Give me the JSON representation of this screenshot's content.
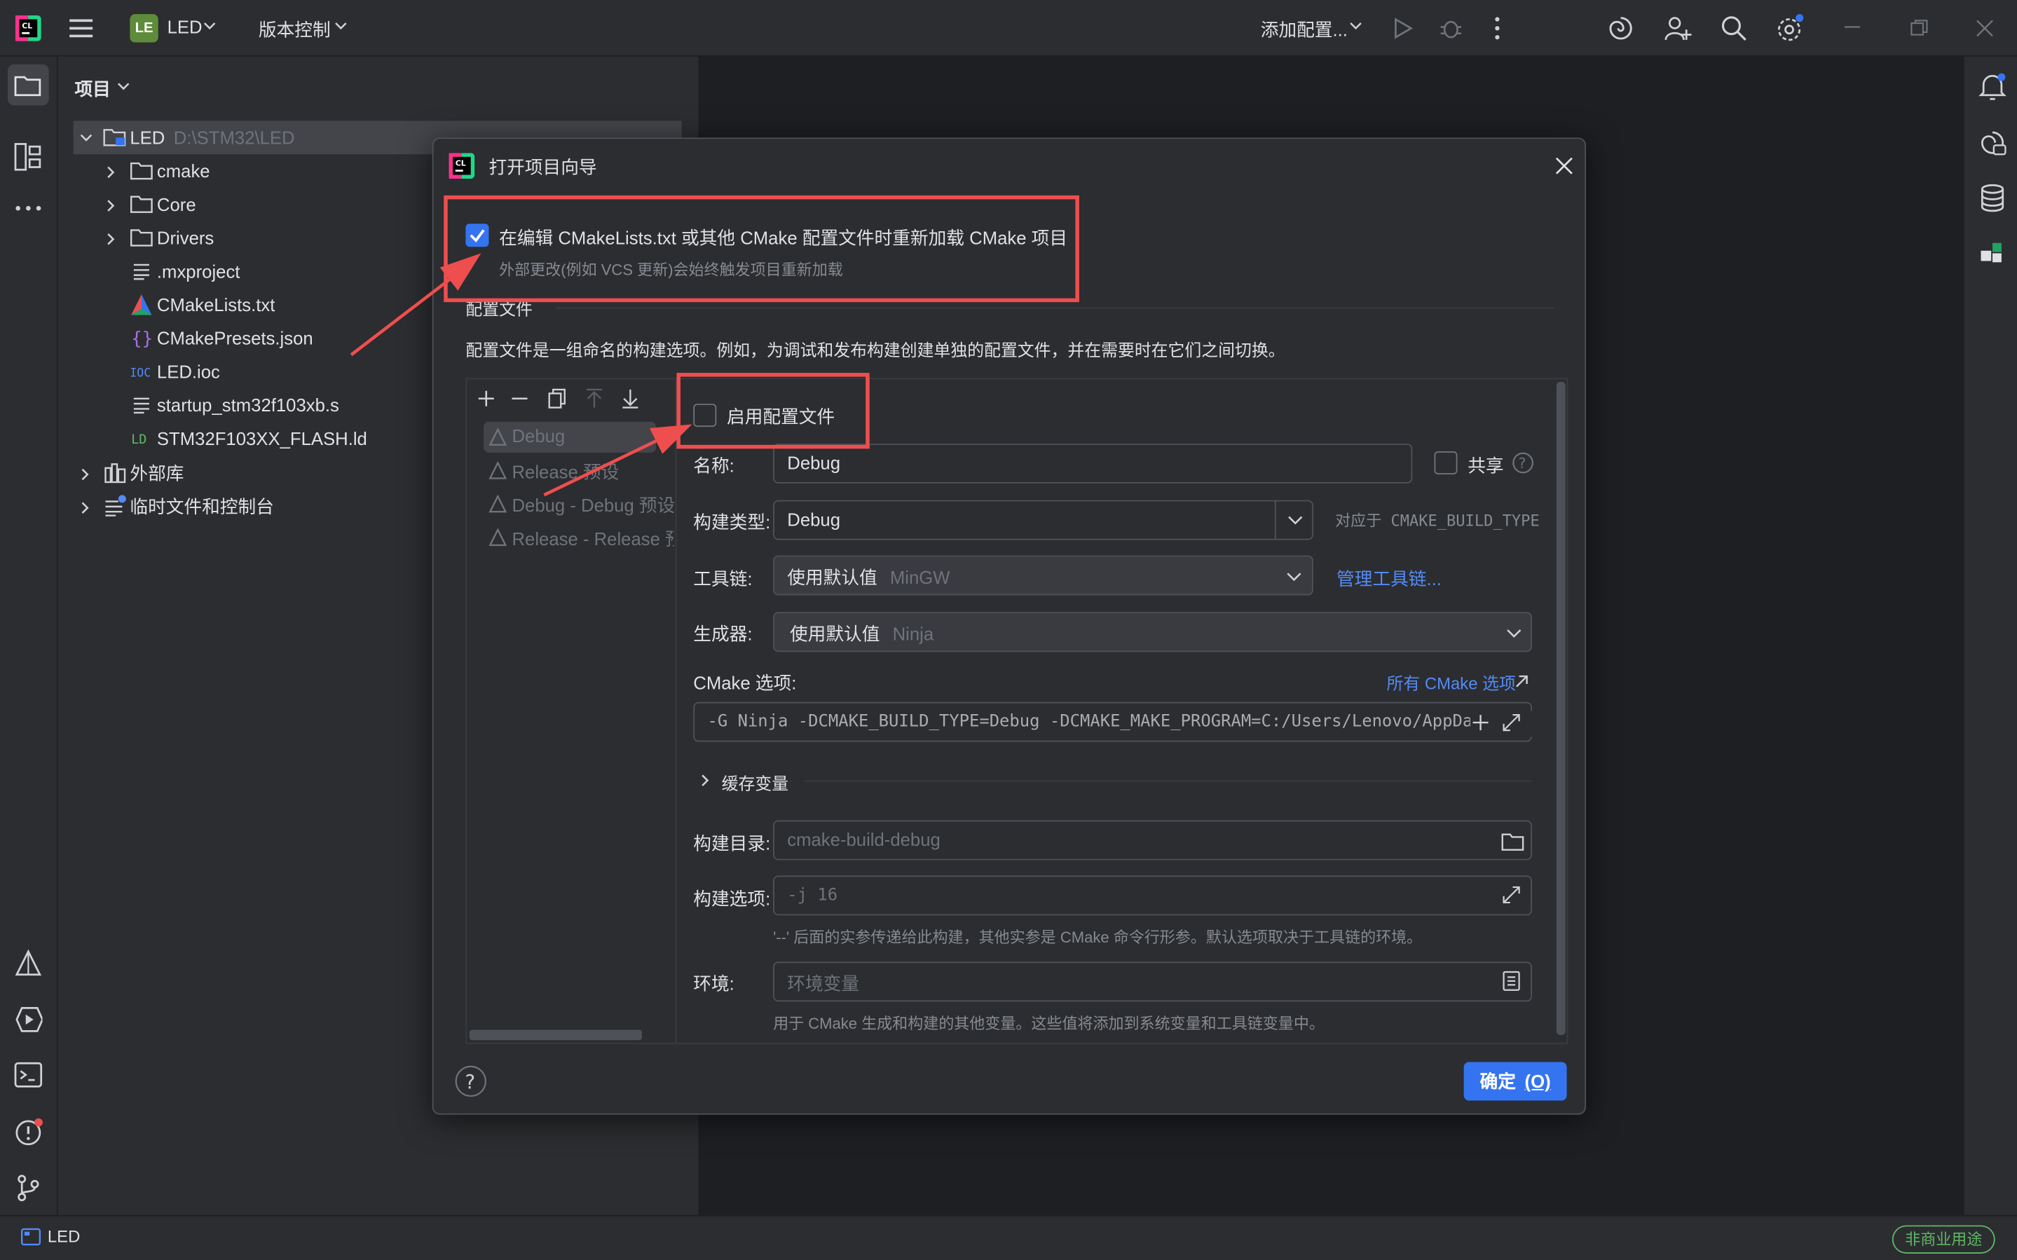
{
  "titlebar": {
    "project_badge": "LE",
    "project_name": "LED",
    "vcs_menu": "版本控制",
    "add_config": "添加配置...",
    "icons": [
      "app-logo-icon",
      "hamburger-menu-icon",
      "run-icon",
      "debug-icon",
      "more-icon",
      "ai-spiral-icon",
      "add-user-icon",
      "search-icon",
      "settings-icon",
      "minimize-icon",
      "restore-icon",
      "close-icon"
    ]
  },
  "project_panel": {
    "header": "项目",
    "tree": [
      {
        "label": "LED",
        "path": "D:\\STM32\\LED",
        "icon": "folder-icon",
        "level": 0,
        "expanded": true
      },
      {
        "label": "cmake",
        "icon": "folder-icon",
        "level": 1
      },
      {
        "label": "Core",
        "icon": "folder-icon",
        "level": 1
      },
      {
        "label": "Drivers",
        "icon": "folder-icon",
        "level": 1
      },
      {
        "label": ".mxproject",
        "icon": "text-file-icon",
        "level": 2
      },
      {
        "label": "CMakeLists.txt",
        "icon": "cmake-icon",
        "level": 2
      },
      {
        "label": "CMakePresets.json",
        "icon": "json-icon",
        "level": 2
      },
      {
        "label": "LED.ioc",
        "icon": "ioc-icon",
        "level": 2
      },
      {
        "label": "startup_stm32f103xb.s",
        "icon": "text-file-icon",
        "level": 2
      },
      {
        "label": "STM32F103XX_FLASH.ld",
        "icon": "ld-file-icon",
        "level": 2
      },
      {
        "label": "外部库",
        "icon": "library-icon",
        "level": 0
      },
      {
        "label": "临时文件和控制台",
        "icon": "scratch-icon",
        "level": 0
      }
    ]
  },
  "dialog": {
    "title": "打开项目向导",
    "reload_checkbox": {
      "label": "在编辑 CMakeLists.txt 或其他 CMake 配置文件时重新加载 CMake 项目",
      "checked": true
    },
    "reload_hint": "外部更改(例如 VCS 更新)会始终触发项目重新加载",
    "section_title": "配置文件",
    "section_desc": "配置文件是一组命名的构建选项。例如，为调试和发布构建创建单独的配置文件，并在需要时在它们之间切换。",
    "profiles": [
      "Debug",
      "Release 预设",
      "Debug - Debug 预设",
      "Release - Release 预设"
    ],
    "enable_profile": {
      "label": "启用配置文件",
      "checked": false
    },
    "name_label": "名称:",
    "name_value": "Debug",
    "share_label": "共享",
    "build_type_label": "构建类型:",
    "build_type_value": "Debug",
    "build_type_hint": "对应于 CMAKE_BUILD_TYPE",
    "toolchain_label": "工具链:",
    "toolchain_value": "使用默认值",
    "toolchain_sub": "MinGW",
    "manage_toolchains": "管理工具链...",
    "generator_label": "生成器:",
    "generator_value": "使用默认值",
    "generator_sub": "Ninja",
    "cmake_options_label": "CMake 选项:",
    "all_cmake_options": "所有 CMake 选项",
    "cmake_options_value": "-G Ninja -DCMAKE_BUILD_TYPE=Debug -DCMAKE_MAKE_PROGRAM=C:/Users/Lenovo/AppDat",
    "cache_vars": "缓存变量",
    "build_dir_label": "构建目录:",
    "build_dir_placeholder": "cmake-build-debug",
    "build_opts_label": "构建选项:",
    "build_opts_placeholder": "-j 16",
    "build_opts_hint": "'--' 后面的实参传递给此构建，其他实参是 CMake 命令行形参。默认选项取决于工具链的环境。",
    "env_label": "环境:",
    "env_placeholder": "环境变量",
    "env_hint": "用于 CMake 生成和构建的其他变量。这些值将添加到系统变量和工具链变量中。",
    "ok_button": "确定",
    "ok_mnemonic": "(O)"
  },
  "statusbar": {
    "project": "LED",
    "license": "非商业用途"
  },
  "colors": {
    "accent": "#3574f0",
    "annotation_red": "#ef4e4e",
    "link": "#548af7"
  }
}
